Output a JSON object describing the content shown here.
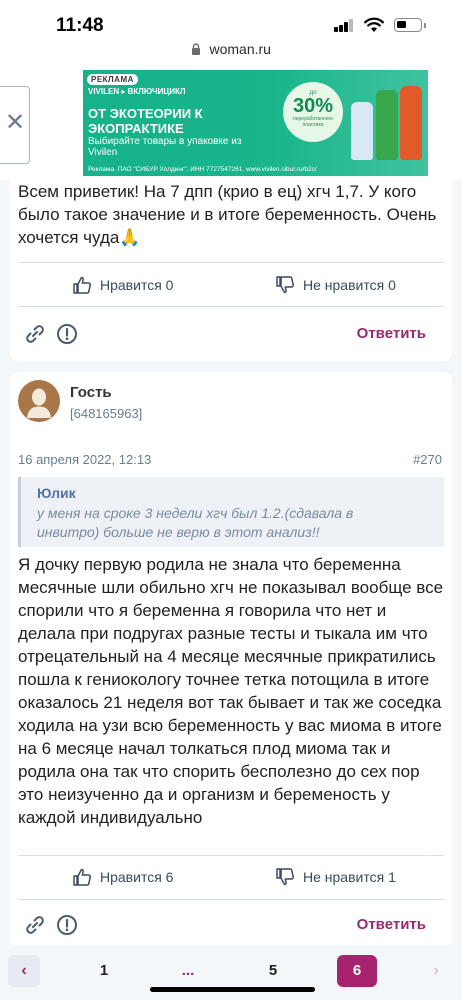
{
  "status_bar": {
    "time": "11:48"
  },
  "browser": {
    "url": "woman.ru"
  },
  "ad": {
    "tag": "РЕКЛАМА",
    "brand": "VIVILEN ▸ ВКЛЮЧИЦИКЛ",
    "headline": "ОТ ЭКОТЕОРИИ К ЭКОПРАКТИКЕ",
    "subtitle": "Выбирайте товары в упаковке из Vivilen",
    "badge_pre": "до",
    "badge_percent": "30%",
    "badge_post": "переработанного пластика",
    "legal": "Реклама. ПАО \"СИБУР Холдинг\". ИНН 7727547261. www.vivilen.sibur.ru/b2c/",
    "close_icon": "close-icon"
  },
  "post1": {
    "text": "Всем приветик! На 7 дпп (крио в ец) хгч 1,7. У кого было такое значение и в итоге беременность. Очень хочется чуда🙏",
    "like_label": "Нравится 0",
    "dislike_label": "Не нравится 0",
    "reply_label": "Ответить"
  },
  "post2": {
    "author": "Гость",
    "author_id": "[648165963]",
    "date": "16 апреля 2022, 12:13",
    "number": "#270",
    "quote_author": "Юлик",
    "quote_text": "у меня на сроке 3 недели хгч был 1.2.(сдавала в инвитро) больше не верю в этот анализ!!",
    "text": "Я дочку первую родила не знала что беременна месячные шли обильно хгч не показывал вообще все спорили что я беременна я говорила что нет и делала при подругах разные тесты и тыкала им что отрецательный на 4 месяце месячные прикратились пошла к гениокологу точнее тетка потощила в итоге оказалось 21 неделя вот так бывает и так же соседка ходила на узи всю беременность у вас миома в итоге на 6 месяце начал толкаться плод миома так и родила она так что спорить бесполезно до сех пор это неизученно да и организм и беременость у каждой индивидуально",
    "like_label": "Нравится 6",
    "dislike_label": "Не нравится 1",
    "reply_label": "Ответить"
  },
  "pagination": {
    "prev": "‹",
    "pages": [
      "1",
      "...",
      "5"
    ],
    "current": "6",
    "next": "›"
  },
  "colors": {
    "accent": "#a8236e",
    "reply": "#9a2a6e",
    "ad_green": "#1ab58b",
    "meta": "#6a7c91"
  }
}
